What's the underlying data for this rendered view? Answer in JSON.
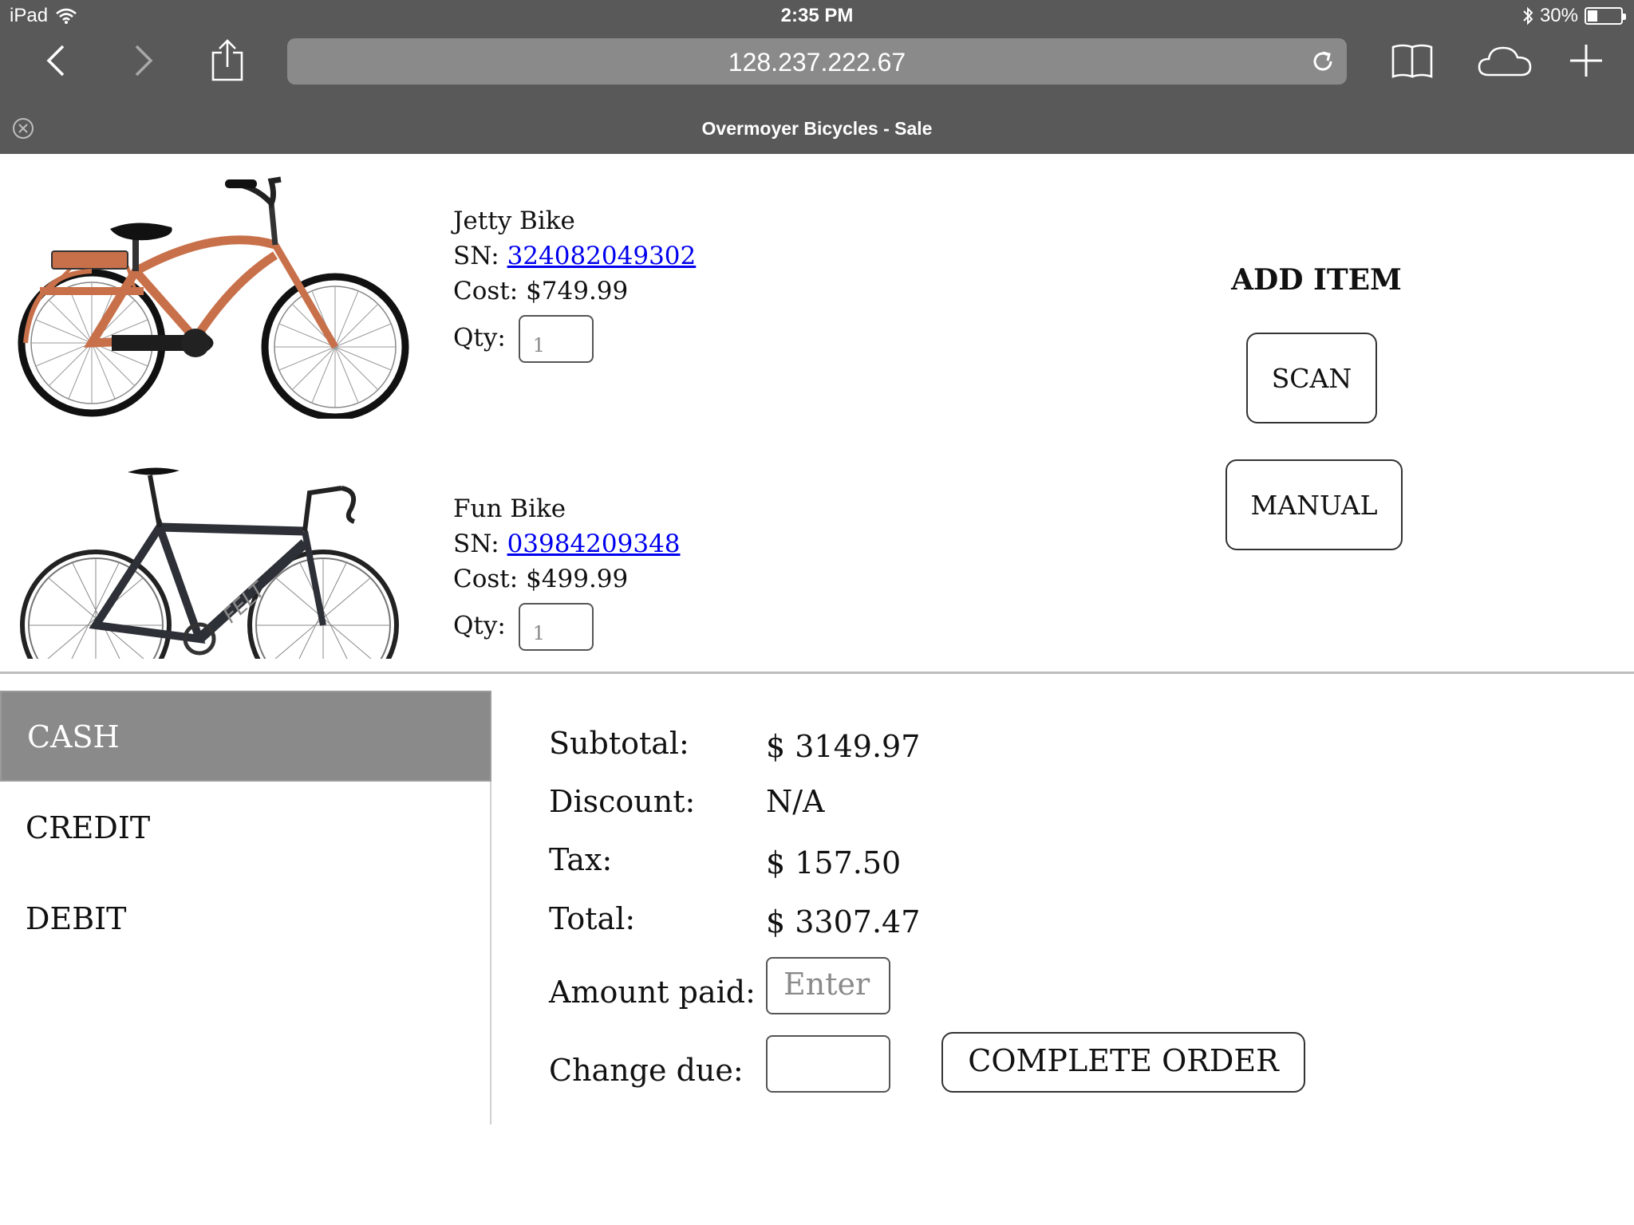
{
  "status_bar": {
    "device": "iPad",
    "time": "2:35 PM",
    "battery": "30%",
    "battery_level": 0.3
  },
  "browser": {
    "url": "128.237.222.67",
    "tab_title": "Overmoyer Bicycles - Sale"
  },
  "items": [
    {
      "name": "Jetty Bike",
      "sn_label": "SN:",
      "sn": "324082049302",
      "cost_label": "Cost:",
      "cost": "$749.99",
      "qty_label": "Qty:",
      "qty": "1"
    },
    {
      "name": "Fun Bike",
      "sn_label": "SN:",
      "sn": "03984209348",
      "cost_label": "Cost:",
      "cost": "$499.99",
      "qty_label": "Qty:",
      "qty": "1"
    }
  ],
  "add_item": {
    "title": "ADD ITEM",
    "scan_label": "SCAN",
    "manual_label": "MANUAL"
  },
  "payment_methods": [
    "CASH",
    "CREDIT",
    "DEBIT"
  ],
  "selected_payment": "CASH",
  "totals": {
    "subtotal_label": "Subtotal:",
    "subtotal": "$ 3149.97",
    "discount_label": "Discount:",
    "discount": "N/A",
    "tax_label": "Tax:",
    "tax": "$ 157.50",
    "total_label": "Total:",
    "total": "$ 3307.47",
    "amount_paid_label": "Amount paid:",
    "amount_paid_placeholder": "Enter",
    "change_due_label": "Change due:",
    "change_due": ""
  },
  "complete_order_label": "COMPLETE ORDER",
  "colors": {
    "chrome": "#595959",
    "url_field": "#8a8a8a",
    "selected_tab": "#8a8a8a",
    "link": "#0000ee",
    "bike1_frame": "#c8704a",
    "bike2_frame": "#2e3038"
  }
}
